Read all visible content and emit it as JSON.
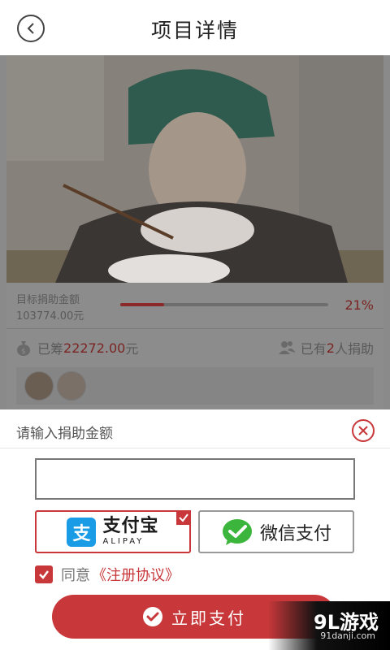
{
  "header": {
    "title": "项目详情"
  },
  "project": {
    "target_label": "目标捐助金额",
    "target_amount": "103774.00元",
    "progress_percent": 21,
    "progress_text": "21%",
    "raised_prefix": "已筹",
    "raised_amount": "22272.00",
    "raised_suffix": "元",
    "donors_prefix": "已有",
    "donors_count": "2",
    "donors_suffix": "人捐助"
  },
  "sheet": {
    "title": "请输入捐助金额",
    "amount_value": "",
    "amount_placeholder": ""
  },
  "payment": {
    "alipay_cn": "支付宝",
    "alipay_en": "ALIPAY",
    "alipay_mark": "支",
    "wechat_label": "微信支付",
    "selected": "alipay"
  },
  "agreement": {
    "text": "同意",
    "link": "《注册协议》",
    "checked": true
  },
  "pay_button": {
    "label": "立即支付"
  },
  "watermark": {
    "brand": "9L游戏",
    "site": "91danji.com"
  },
  "colors": {
    "accent": "#c8383a",
    "alipay_blue": "#1a9be6",
    "wechat_green": "#3bb53b"
  },
  "icons": [
    "back-icon",
    "close-icon",
    "money-bag-icon",
    "people-icon",
    "check-icon",
    "wechat-icon",
    "alipay-icon"
  ]
}
